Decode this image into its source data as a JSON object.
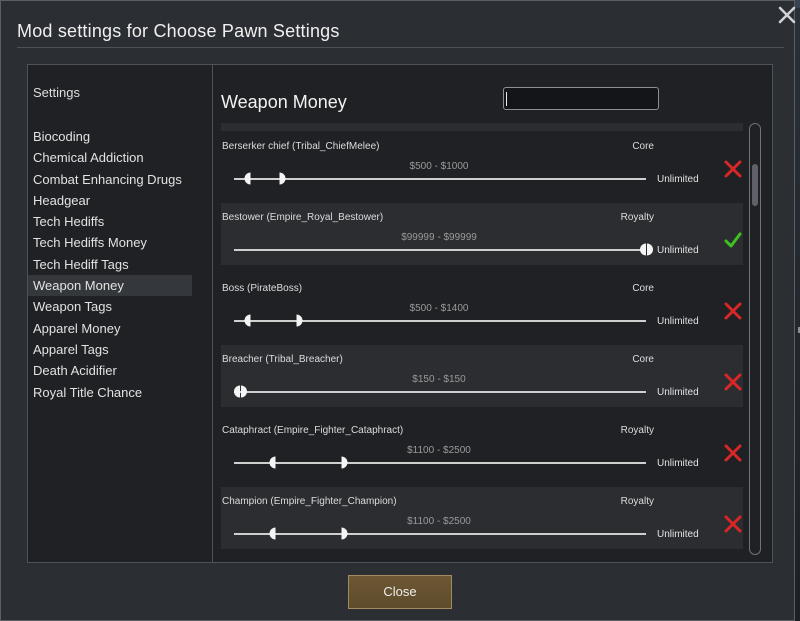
{
  "dialog": {
    "title": "Mod settings for Choose Pawn Settings",
    "close_label": "Close",
    "close_x_icon": "close-icon"
  },
  "sidebar": {
    "header": "Settings",
    "items": [
      {
        "label": "Biocoding",
        "active": false
      },
      {
        "label": "Chemical Addiction",
        "active": false
      },
      {
        "label": "Combat Enhancing Drugs",
        "active": false
      },
      {
        "label": "Headgear",
        "active": false
      },
      {
        "label": "Tech Hediffs",
        "active": false
      },
      {
        "label": "Tech Hediffs Money",
        "active": false
      },
      {
        "label": "Tech Hediff Tags",
        "active": false
      },
      {
        "label": "Weapon Money",
        "active": true
      },
      {
        "label": "Weapon Tags",
        "active": false
      },
      {
        "label": "Apparel Money",
        "active": false
      },
      {
        "label": "Apparel Tags",
        "active": false
      },
      {
        "label": "Death Acidifier",
        "active": false
      },
      {
        "label": "Royal Title Chance",
        "active": false
      }
    ]
  },
  "main": {
    "section_title": "Weapon Money",
    "search": {
      "value": "",
      "placeholder": ""
    },
    "scroll_position": 0.1,
    "rows": [
      {
        "name": "Berserker chief (Tribal_ChiefMelee)",
        "source": "Core",
        "range": "$500 - $1000",
        "min_fraction": 0.04,
        "max_fraction": 0.11,
        "unlimited": "Unlimited",
        "enabled": false
      },
      {
        "name": "Bestower (Empire_Royal_Bestower)",
        "source": "Royalty",
        "range": "$99999 - $99999",
        "min_fraction": 1.0,
        "max_fraction": 1.0,
        "unlimited": "Unlimited",
        "enabled": true
      },
      {
        "name": "Boss (PirateBoss)",
        "source": "Core",
        "range": "$500 - $1400",
        "min_fraction": 0.04,
        "max_fraction": 0.15,
        "unlimited": "Unlimited",
        "enabled": false
      },
      {
        "name": "Breacher (Tribal_Breacher)",
        "source": "Core",
        "range": "$150 - $150",
        "min_fraction": 0.015,
        "max_fraction": 0.015,
        "unlimited": "Unlimited",
        "enabled": false
      },
      {
        "name": "Cataphract (Empire_Fighter_Cataphract)",
        "source": "Royalty",
        "range": "$1100 - $2500",
        "min_fraction": 0.1,
        "max_fraction": 0.26,
        "unlimited": "Unlimited",
        "enabled": false
      },
      {
        "name": "Champion (Empire_Fighter_Champion)",
        "source": "Royalty",
        "range": "$1100 - $2500",
        "min_fraction": 0.1,
        "max_fraction": 0.26,
        "unlimited": "Unlimited",
        "enabled": false
      }
    ]
  },
  "colors": {
    "check": "#3ec21f",
    "cross": "#d92626",
    "close_button": "#6d5834"
  }
}
